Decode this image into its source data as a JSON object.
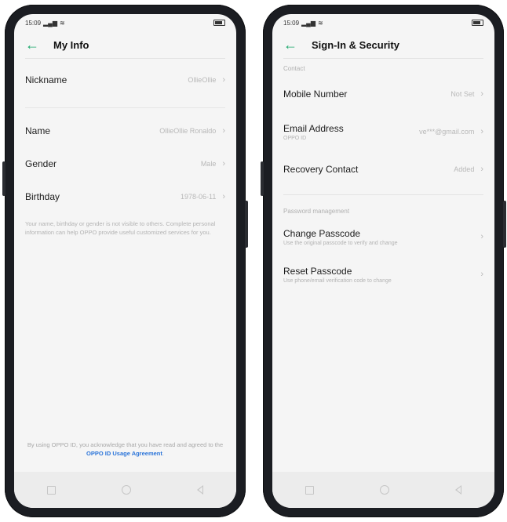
{
  "status": {
    "time": "15:09"
  },
  "left": {
    "title": "My Info",
    "rows": [
      {
        "label": "Nickname",
        "value": "OllieOllie"
      },
      {
        "label": "Name",
        "value": "OllieOllie Ronaldo"
      },
      {
        "label": "Gender",
        "value": "Male"
      },
      {
        "label": "Birthday",
        "value": "1978-06-11"
      }
    ],
    "note": "Your name, birthday or gender is not visible to others. Complete personal information can help OPPO provide useful customized services for you.",
    "footer_text": "By using OPPO ID, you acknowledge that you have read and agreed to the",
    "footer_link": "OPPO ID Usage Agreement",
    "footer_end": "."
  },
  "right": {
    "title": "Sign-In & Security",
    "section_contact": "Contact",
    "rows": [
      {
        "label": "Mobile Number",
        "value": "Not Set"
      },
      {
        "label": "Email Address",
        "sub": "OPPO ID",
        "value": "ve***@gmail.com"
      },
      {
        "label": "Recovery Contact",
        "value": "Added"
      }
    ],
    "section_password": "Password management",
    "password_rows": [
      {
        "label": "Change Passcode",
        "sub": "Use the original passcode to verify and change"
      },
      {
        "label": "Reset Passcode",
        "sub": "Use phone/email verification code to change"
      }
    ]
  },
  "icons": {
    "back": "back-arrow-icon",
    "chevron": "chevron-right-icon"
  },
  "colors": {
    "accent": "#1aa86b",
    "link": "#2a74d9"
  }
}
